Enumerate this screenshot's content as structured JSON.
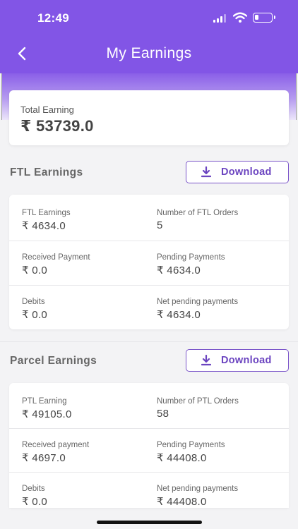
{
  "status_bar": {
    "time": "12:49"
  },
  "header": {
    "title": "My Earnings"
  },
  "total": {
    "label": "Total Earning",
    "value": "₹ 53739.0"
  },
  "ftl": {
    "title": "FTL Earnings",
    "download_label": "Download",
    "rows": [
      [
        {
          "label": "FTL Earnings",
          "value": "₹ 4634.0"
        },
        {
          "label": "Number of FTL Orders",
          "value": "5"
        }
      ],
      [
        {
          "label": "Received Payment",
          "value": "₹ 0.0"
        },
        {
          "label": "Pending Payments",
          "value": "₹ 4634.0"
        }
      ],
      [
        {
          "label": "Debits",
          "value": "₹ 0.0"
        },
        {
          "label": "Net pending payments",
          "value": "₹ 4634.0"
        }
      ]
    ]
  },
  "parcel": {
    "title": "Parcel Earnings",
    "download_label": "Download",
    "rows": [
      [
        {
          "label": "PTL Earning",
          "value": "₹ 49105.0"
        },
        {
          "label": "Number of PTL Orders",
          "value": "58"
        }
      ],
      [
        {
          "label": "Received payment",
          "value": "₹ 4697.0"
        },
        {
          "label": "Pending Payments",
          "value": "₹ 44408.0"
        }
      ],
      [
        {
          "label": "Debits",
          "value": "₹ 0.0"
        },
        {
          "label": "Net pending payments",
          "value": "₹ 44408.0"
        }
      ]
    ]
  },
  "icons": {
    "back": "chevron-left-icon",
    "download": "download-icon"
  },
  "colors": {
    "accent": "#8255e6",
    "button_text": "#6b44c0"
  }
}
